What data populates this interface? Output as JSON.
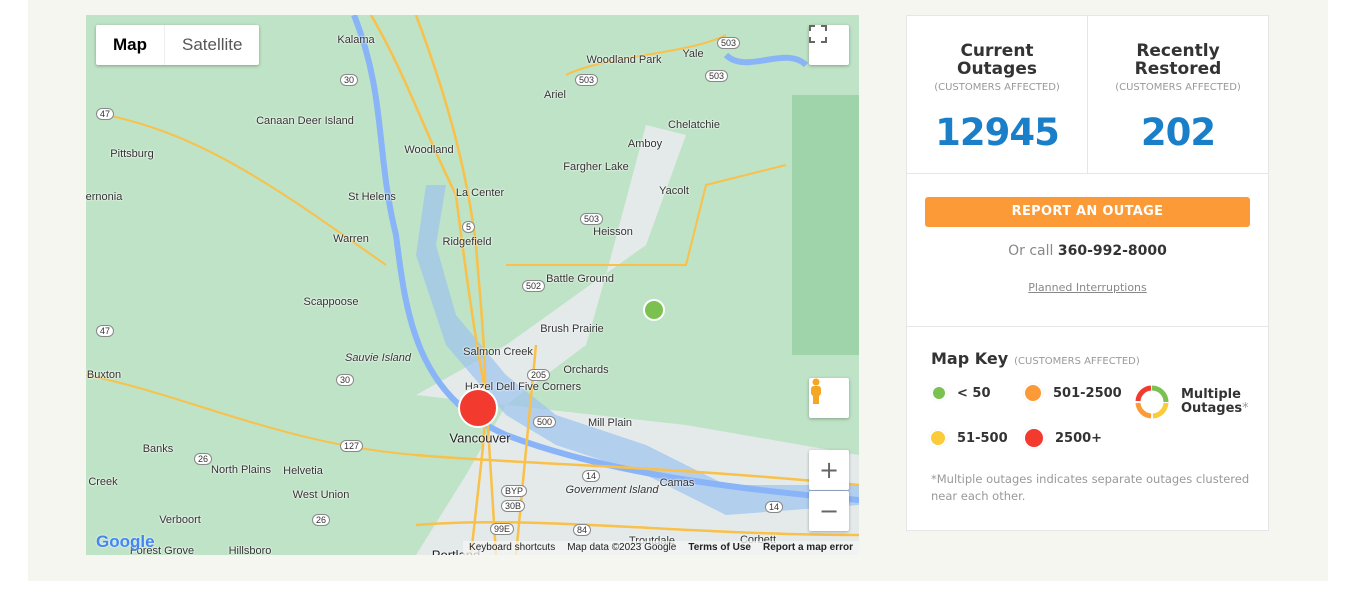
{
  "map": {
    "type_buttons": [
      "Map",
      "Satellite"
    ],
    "labels": [
      "Kalama",
      "Woodland Park",
      "Yale",
      "Ariel",
      "Canaan Deer Island",
      "Chelatchie",
      "Pittsburg",
      "Woodland",
      "Amboy",
      "Fargher Lake",
      "Yacolt",
      "La Center",
      "St Helens",
      "ernonia",
      "Heisson",
      "Warren",
      "Ridgefield",
      "Battle Ground",
      "Scappoose",
      "Brush Prairie",
      "Sauvie Island",
      "Salmon Creek",
      "Orchards",
      "Buxton",
      "Hazel Dell Five Corners",
      "Vancouver",
      "Mill Plain",
      "Banks",
      "North Plains",
      "Helvetia",
      "Creek",
      "Government Island",
      "Camas",
      "West Union",
      "Verboort",
      "Forest Grove",
      "Hillsboro",
      "Troutdale",
      "Corbett",
      "Portland"
    ],
    "shields": [
      "503",
      "503",
      "503",
      "30",
      "47",
      "47",
      "5",
      "503",
      "502",
      "205",
      "500",
      "30",
      "26",
      "127",
      "14",
      "14",
      "26",
      "BYP",
      "30B",
      "99E",
      "84"
    ],
    "google_logo": "Google",
    "attribution": {
      "keyboard": "Keyboard shortcuts",
      "data": "Map data ©2023 Google",
      "terms": "Terms of Use",
      "report": "Report a map error"
    },
    "controls": {
      "fullscreen": "fullscreen-icon",
      "pegman": "pegman-icon",
      "zoom_in": "+",
      "zoom_out": "−"
    },
    "markers": [
      {
        "category": "2500+",
        "color": "#f23a2f"
      },
      {
        "category": "< 50",
        "color": "#7bc14f"
      }
    ]
  },
  "panel": {
    "current": {
      "title": "Current Outages",
      "sub": "(CUSTOMERS AFFECTED)",
      "value": "12945"
    },
    "restored": {
      "title": "Recently Restored",
      "sub": "(CUSTOMERS AFFECTED)",
      "value": "202"
    },
    "report_button": "REPORT AN OUTAGE",
    "call_prefix": "Or call",
    "phone": "360-992-8000",
    "planned_link": "Planned Interruptions",
    "key": {
      "title": "Map Key",
      "sub": "(CUSTOMERS AFFECTED)",
      "items": [
        {
          "label": "< 50",
          "color": "#7bc14f"
        },
        {
          "label": "501-2500",
          "color": "#fb9a37"
        },
        {
          "label": "51-500",
          "color": "#fbcb3a"
        },
        {
          "label": "2500+",
          "color": "#f23a2f"
        }
      ],
      "multiple": "Multiple Outages",
      "asterisk": "*",
      "note": "*Multiple outages indicates separate outages clustered near each other."
    }
  },
  "colors": {
    "accent": "#1a7fc9",
    "button": "#fb9a37"
  }
}
